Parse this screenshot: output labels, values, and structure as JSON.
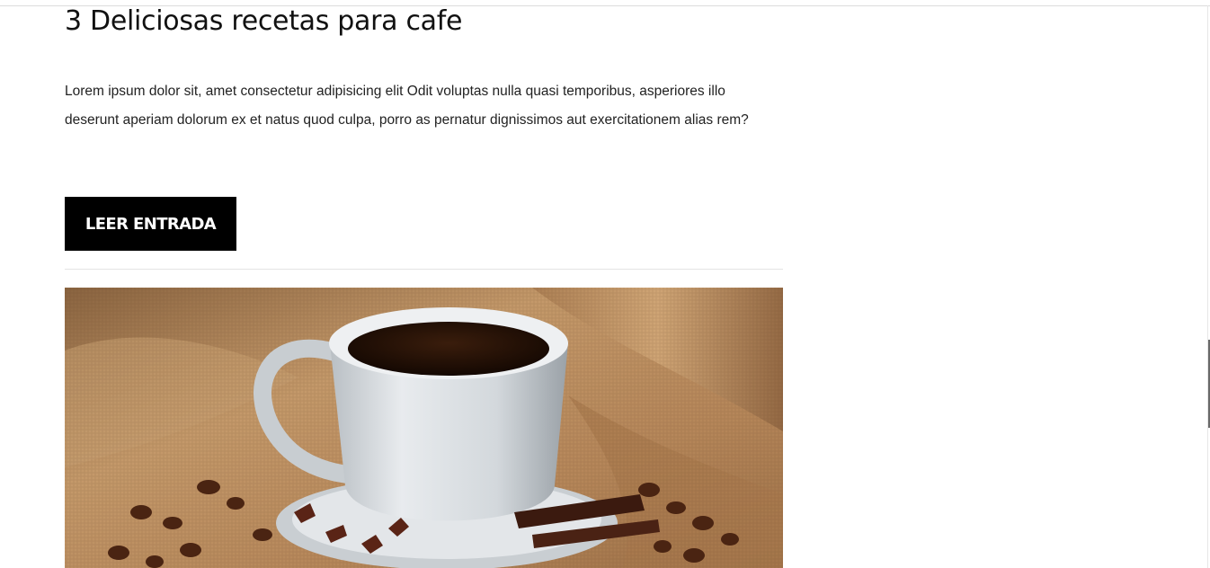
{
  "post": {
    "title": "3 Deliciosas recetas para cafe",
    "excerpt": "Lorem ipsum dolor sit, amet consectetur adipisicing elit Odit voluptas nulla quasi temporibus, asperiores illo deserunt aperiam dolorum ex et natus quod culpa, porro as pernatur dignissimos aut exercitationem alias rem?",
    "button_label": "LEER ENTRADA",
    "image_icon": "coffee-cup-photo"
  },
  "colors": {
    "button_bg": "#000000",
    "button_text": "#ffffff",
    "divider": "#e4e4e4",
    "burlap": "#b88a5a",
    "cup": "#d9dde0",
    "coffee": "#2a1408"
  }
}
